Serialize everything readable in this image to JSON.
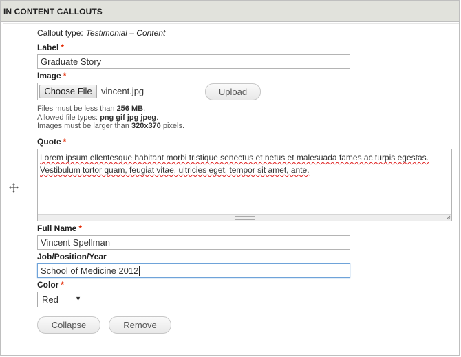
{
  "panel": {
    "title": "IN CONTENT CALLOUTS"
  },
  "callout": {
    "type_label": "Callout type:",
    "type_value": "Testimonial – Content"
  },
  "fields": {
    "label": {
      "label": "Label",
      "required": "*",
      "value": "Graduate Story"
    },
    "image": {
      "label": "Image",
      "required": "*",
      "choose_label": "Choose File",
      "file_name": "vincent.jpg",
      "upload_label": "Upload",
      "help_size_prefix": "Files must be less than ",
      "help_size_value": "256 MB",
      "help_size_suffix": ".",
      "help_types_prefix": "Allowed file types: ",
      "help_types_value": "png gif jpg jpeg",
      "help_types_suffix": ".",
      "help_dims_prefix": "Images must be larger than ",
      "help_dims_value": "320x370",
      "help_dims_suffix": " pixels."
    },
    "quote": {
      "label": "Quote",
      "required": "*",
      "value": "Lorem ipsum ellentesque habitant morbi tristique senectus et netus et malesuada fames ac turpis egestas. Vestibulum tortor quam, feugiat vitae, ultricies eget, tempor sit amet, ante."
    },
    "full_name": {
      "label": "Full Name",
      "required": "*",
      "value": "Vincent Spellman"
    },
    "job": {
      "label": "Job/Position/Year",
      "value": "School of Medicine 2012"
    },
    "color": {
      "label": "Color",
      "required": "*",
      "value": "Red"
    }
  },
  "actions": {
    "collapse_label": "Collapse",
    "remove_label": "Remove"
  },
  "icons": {
    "drag": "drag-handle-icon",
    "dropdown": "chevron-down-icon",
    "resize": "resize-grip-icon"
  }
}
